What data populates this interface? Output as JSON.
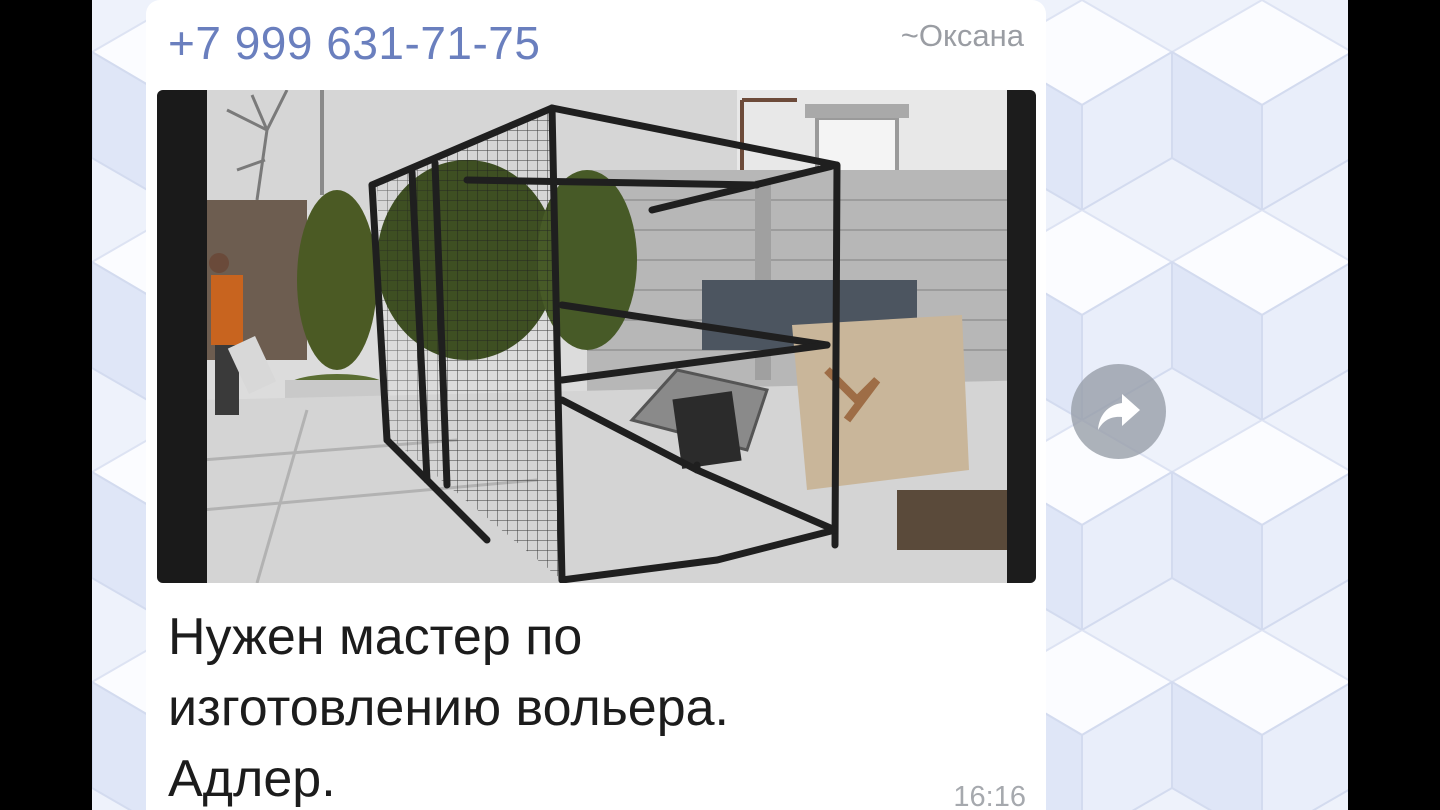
{
  "message": {
    "sender_phone": "+7 999 631-71-75",
    "sender_name": "~Оксана",
    "text": "Нужен мастер по изготовлению вольера. Адлер.",
    "time": "16:16",
    "photo_icon": "enclosure-photo"
  },
  "actions": {
    "forward_icon": "share-arrow-icon"
  },
  "colors": {
    "sender": "#6a7fbe",
    "wallpaper": "#eef2fb",
    "bubble": "#ffffff"
  }
}
